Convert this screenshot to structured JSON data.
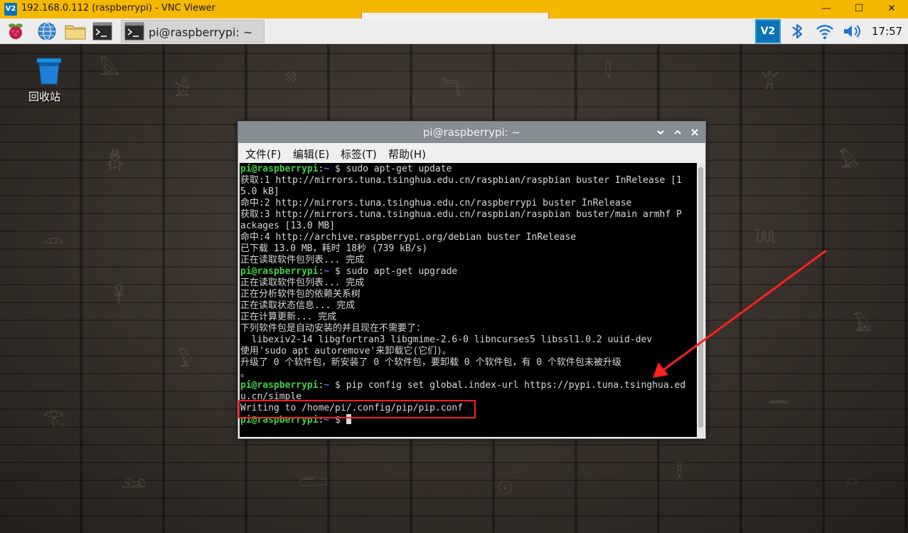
{
  "vnc": {
    "title": "192.168.0.112 (raspberrypi) - VNC Viewer",
    "logo": "V2",
    "minimize_glyph": "—",
    "maximize_glyph": "☐",
    "close_glyph": "✕"
  },
  "taskbar": {
    "icons": [
      "raspberry-menu-icon",
      "web-browser-icon",
      "file-manager-icon",
      "terminal-icon"
    ],
    "window_button": "pi@raspberrypi: ~",
    "tray": {
      "vnc_label": "V2",
      "bluetooth_icon": "bluetooth-icon",
      "wifi_icon": "wifi-icon",
      "volume_icon": "volume-icon"
    },
    "clock": "17:57"
  },
  "desktop": {
    "trash_label": "回收站"
  },
  "terminal": {
    "title": "pi@raspberrypi: ~",
    "menu": [
      "文件(F)",
      "编辑(E)",
      "标签(T)",
      "帮助(H)"
    ],
    "prompt_user": "pi@raspberrypi",
    "prompt_sep": ":",
    "prompt_path": "~",
    "prompt_dollar": " $ ",
    "lines": [
      {
        "type": "cmd",
        "text": "sudo apt-get update"
      },
      {
        "type": "out",
        "text": "获取:1 http://mirrors.tuna.tsinghua.edu.cn/raspbian/raspbian buster InRelease [1"
      },
      {
        "type": "out",
        "text": "5.0 kB]"
      },
      {
        "type": "out",
        "text": "命中:2 http://mirrors.tuna.tsinghua.edu.cn/raspberrypi buster InRelease"
      },
      {
        "type": "out",
        "text": "获取:3 http://mirrors.tuna.tsinghua.edu.cn/raspbian/raspbian buster/main armhf P"
      },
      {
        "type": "out",
        "text": "ackages [13.0 MB]"
      },
      {
        "type": "out",
        "text": "命中:4 http://archive.raspberrypi.org/debian buster InRelease"
      },
      {
        "type": "out",
        "text": "已下载 13.0 MB，耗时 18秒 (739 kB/s)"
      },
      {
        "type": "out",
        "text": "正在读取软件包列表... 完成"
      },
      {
        "type": "cmd",
        "text": "sudo apt-get upgrade"
      },
      {
        "type": "out",
        "text": "正在读取软件包列表... 完成"
      },
      {
        "type": "out",
        "text": "正在分析软件包的依赖关系树"
      },
      {
        "type": "out",
        "text": "正在读取状态信息... 完成"
      },
      {
        "type": "out",
        "text": "正在计算更新... 完成"
      },
      {
        "type": "out",
        "text": "下列软件包是自动安装的并且现在不需要了："
      },
      {
        "type": "out",
        "text": "  libexiv2-14 libgfortran3 libgmime-2.6-0 libncurses5 libssl1.0.2 uuid-dev"
      },
      {
        "type": "out",
        "text": "使用'sudo apt autoremove'来卸载它(它们)。"
      },
      {
        "type": "out",
        "text": "升级了 0 个软件包，新安装了 0 个软件包，要卸载 0 个软件包，有 0 个软件包未被升级"
      },
      {
        "type": "out",
        "text": "。"
      },
      {
        "type": "cmd",
        "text": "pip config set global.index-url https://pypi.tuna.tsinghua.ed"
      },
      {
        "type": "out",
        "text": "u.cn/simple"
      },
      {
        "type": "out",
        "text": "Writing to /home/pi/.config/pip/pip.conf"
      },
      {
        "type": "cursor",
        "text": ""
      }
    ]
  },
  "colors": {
    "vnc_titlebar": "#f5b800",
    "prompt_green": "#3fd23f",
    "prompt_blue": "#4a7ff0",
    "annotation_red": "#ff2020"
  }
}
